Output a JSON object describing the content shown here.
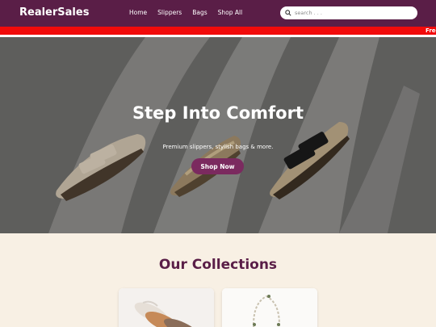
{
  "header": {
    "logo": "RealerSales",
    "nav": [
      "Home",
      "Slippers",
      "Bags",
      "Shop All"
    ],
    "search_placeholder": "search . . ."
  },
  "ticker": {
    "text": "Free"
  },
  "hero": {
    "title": "Step Into Comfort",
    "subtitle": "Premium slippers, stylish bags & more.",
    "button": "Shop Now"
  },
  "collections": {
    "title": "Our Collections"
  },
  "colors": {
    "header_bg": "#5a1e47",
    "ticker_bg": "#f10b0b",
    "accent": "#7b2a5f",
    "page_bg": "#f8f0e4"
  }
}
